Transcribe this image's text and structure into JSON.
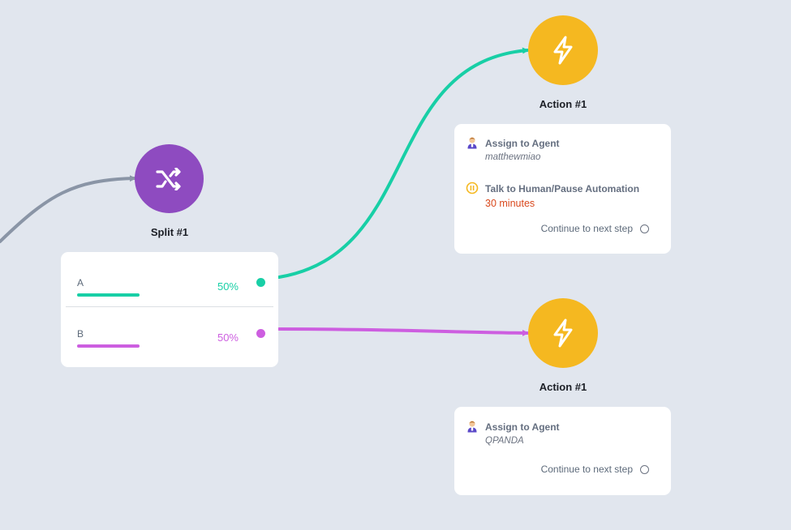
{
  "flow": {
    "split": {
      "label": "Split #1",
      "icon": "shuffle-icon",
      "color": "#8e4bc0",
      "branches": [
        {
          "name": "A",
          "percent": "50%",
          "color": "#18cfa6"
        },
        {
          "name": "B",
          "percent": "50%",
          "color": "#cd5ee0"
        }
      ]
    },
    "actions": [
      {
        "label": "Action #1",
        "icon": "lightning-icon",
        "color": "#f5b820",
        "steps": [
          {
            "icon": "agent-icon",
            "title": "Assign to Agent",
            "value": "matthewmiao"
          },
          {
            "icon": "pause-icon",
            "title": "Talk to Human/Pause Automation",
            "value": "30 minutes"
          }
        ],
        "continue_label": "Continue to next step"
      },
      {
        "label": "Action #1",
        "icon": "lightning-icon",
        "color": "#f5b820",
        "steps": [
          {
            "icon": "agent-icon",
            "title": "Assign to Agent",
            "value": "QPANDA"
          }
        ],
        "continue_label": "Continue to next step"
      }
    ],
    "connector_colors": {
      "incoming": "#8a95a6",
      "branch_a": "#18cfa6",
      "branch_b": "#cd5ee0"
    }
  }
}
